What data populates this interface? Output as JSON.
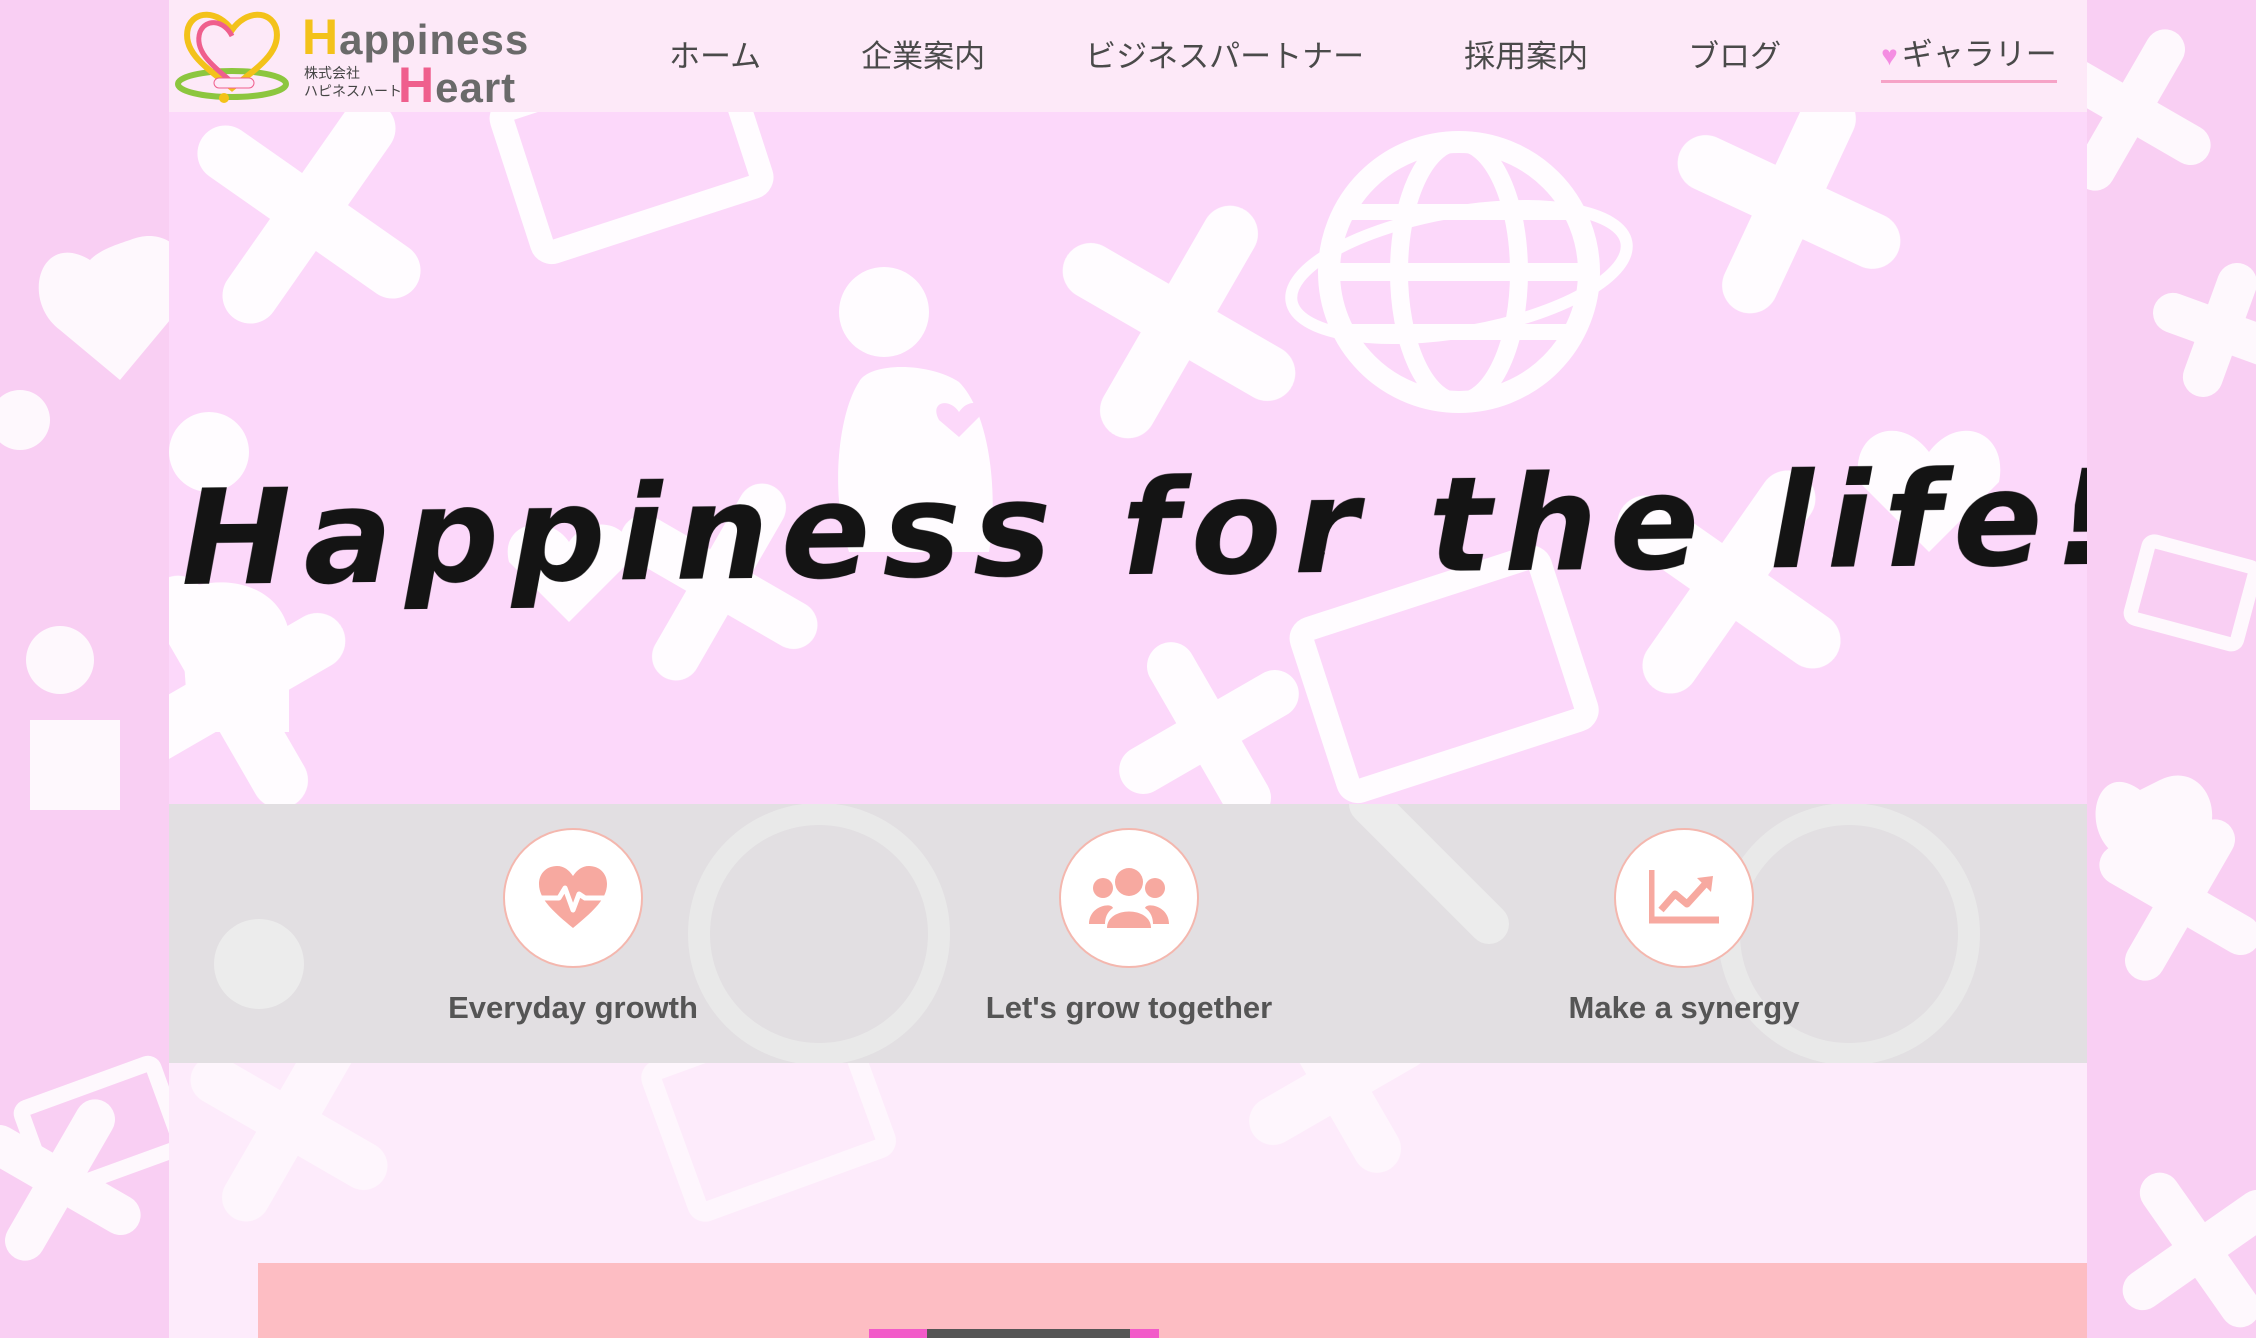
{
  "logo": {
    "line1_cap": "H",
    "line1_rest": "appiness",
    "line2_cap": "H",
    "line2_rest": "eart",
    "sub_line1": "株式会社",
    "sub_line2": "ハピネスハート"
  },
  "nav": {
    "items": [
      {
        "label": "ホーム"
      },
      {
        "label": "企業案内"
      },
      {
        "label": "ビジネスパートナー"
      },
      {
        "label": "採用案内"
      },
      {
        "label": "ブログ"
      },
      {
        "label": "ギャラリー"
      }
    ],
    "active_index": 5
  },
  "hero": {
    "headline": "Happiness for the life!!"
  },
  "features": [
    {
      "icon": "heartbeat-icon",
      "label": "Everyday growth"
    },
    {
      "icon": "users-icon",
      "label": "Let's grow together"
    },
    {
      "icon": "chart-line-icon",
      "label": "Make a synergy"
    }
  ],
  "colors": {
    "background_pink": "#f9cff3",
    "hero_pink": "#fcd8fa",
    "accent_salmon": "#f7a9a0",
    "active_underline": "#f6a3c7",
    "heart_nav": "#f48de2",
    "pink_block": "#fdbdc3"
  }
}
